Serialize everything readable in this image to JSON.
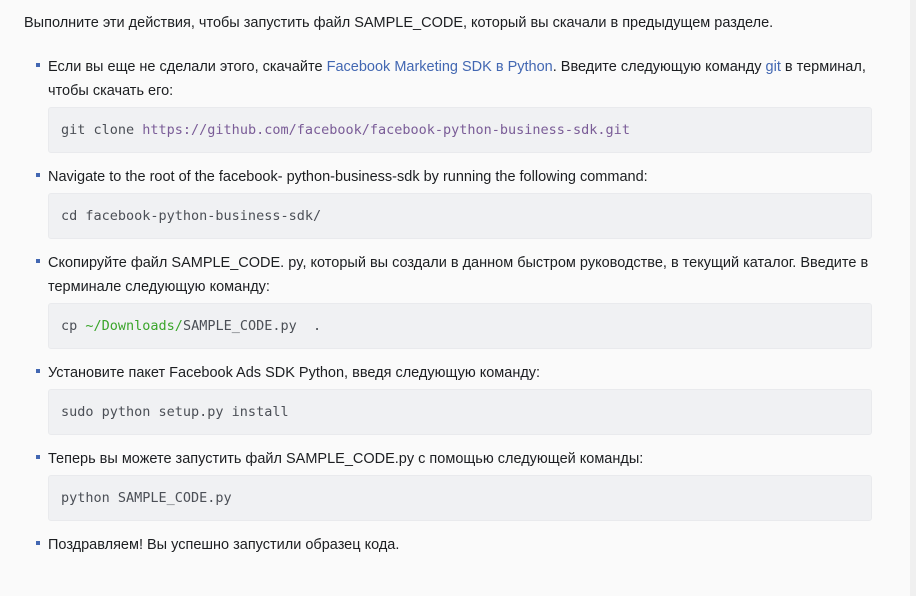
{
  "intro": "Выполните эти действия, чтобы запустить файл SAMPLE_CODE, который вы скачали в предыдущем разделе.",
  "steps": [
    {
      "text_before": "Если вы еще не сделали этого, скачайте ",
      "link1": "Facebook Marketing SDK в Python",
      "text_middle": ". Введите следующую команду ",
      "link2": "git",
      "text_after": " в терминал, чтобы скачать его:",
      "code_cmd": "git clone ",
      "code_url": "https://github.com/facebook/facebook-python-business-sdk.git"
    },
    {
      "text": "Navigate to the root of the facebook- python-business-sdk by running the following command:",
      "code": "cd facebook-python-business-sdk/"
    },
    {
      "text": "Скопируйте файл SAMPLE_CODE. py, который вы создали в данном быстром руководстве, в текущий каталог. Введите в терминале следующую команду:",
      "code_cmd": "cp ",
      "code_path": "~/Downloads/",
      "code_rest": "SAMPLE_CODE.py  ."
    },
    {
      "text": "Установите пакет Facebook Ads SDK Python, введя следующую команду:",
      "code": "sudo python setup.py install"
    },
    {
      "text": "Теперь вы можете запустить файл SAMPLE_CODE.py с помощью следующей команды:",
      "code": "python SAMPLE_CODE.py"
    },
    {
      "text": "Поздравляем! Вы успешно запустили образец кода."
    }
  ],
  "colors": {
    "link": "#4267b2",
    "bullet": "#4267b2",
    "code_bg": "#f0f1f3",
    "code_url": "#7a5c97",
    "code_path": "#3aa52a"
  }
}
